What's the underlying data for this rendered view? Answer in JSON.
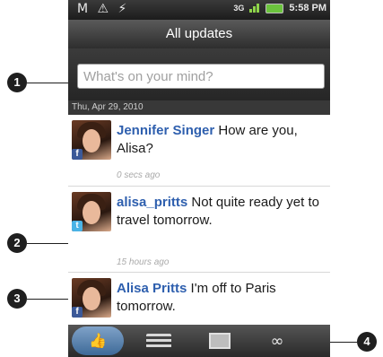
{
  "status_bar": {
    "left_icons": "M ⚠ ⚡",
    "network": "3G",
    "time": "5:58 PM"
  },
  "header": {
    "title": "All updates"
  },
  "compose": {
    "placeholder": "What's on your mind?"
  },
  "feed": {
    "date_label": "Thu, Apr 29, 2010",
    "items": [
      {
        "name": "Jennifer Singer",
        "message": "How are you, Alisa?",
        "time": "0 secs ago",
        "source_icon": "facebook-icon"
      },
      {
        "name": "alisa_pritts",
        "message": "Not quite ready yet to travel tomorrow.",
        "time": "15 hours ago",
        "source_icon": "twitter-icon"
      },
      {
        "name": "Alisa Pritts",
        "message": "I'm off to Paris tomorrow.",
        "time": "",
        "source_icon": "facebook-icon"
      }
    ]
  },
  "toolbar": {
    "buttons": [
      "all-updates-icon",
      "status-icon",
      "photos-icon",
      "links-icon"
    ]
  },
  "callouts": [
    "1",
    "2",
    "3",
    "4"
  ],
  "colors": {
    "name_link": "#2e5fae",
    "active_tab": "#5b84b1",
    "facebook": "#3b5998",
    "twitter": "#4ab3e6"
  }
}
